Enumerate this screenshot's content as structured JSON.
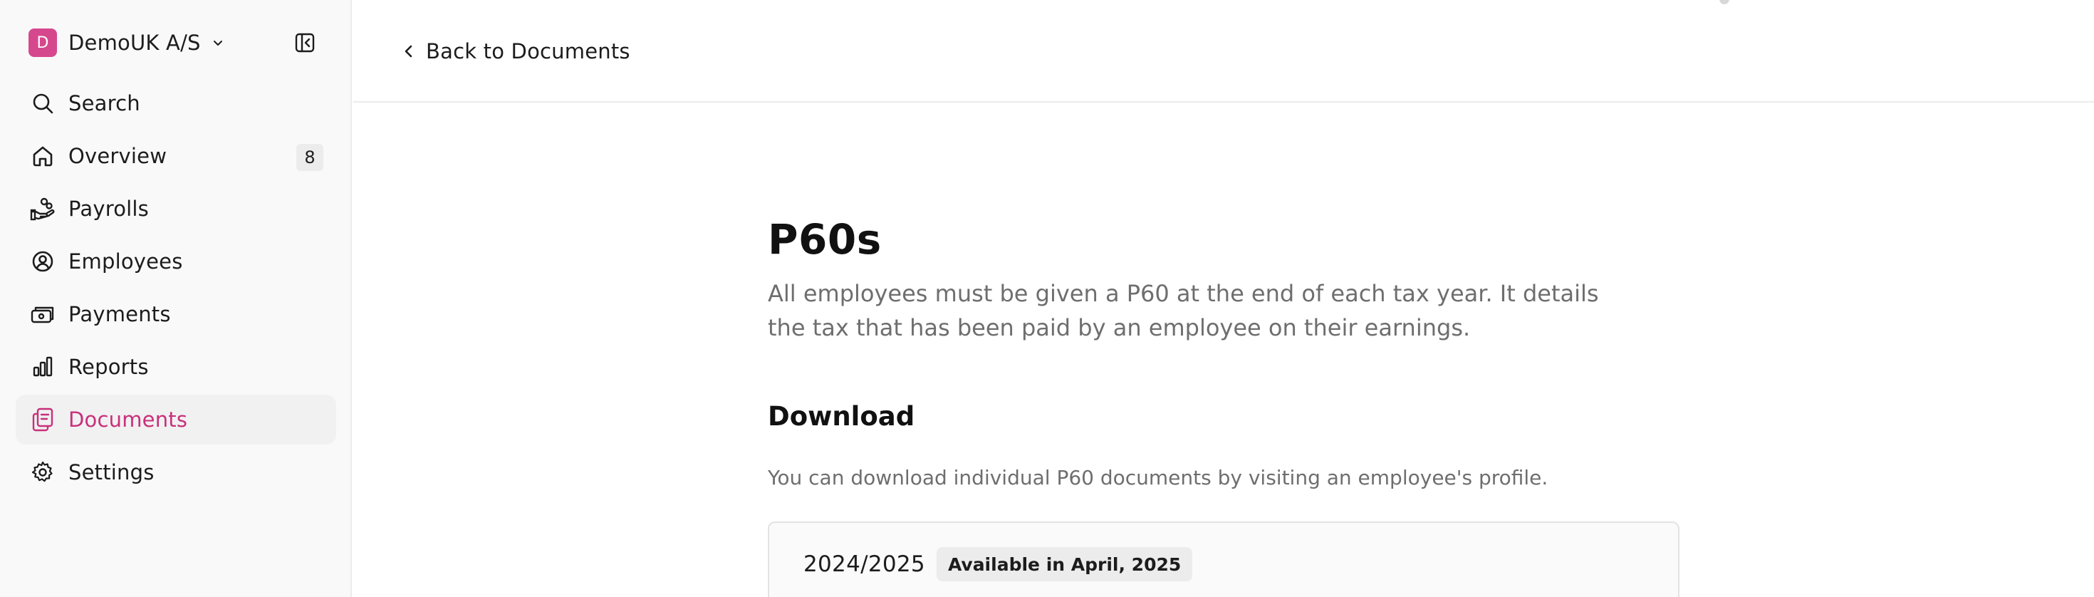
{
  "sidebar": {
    "workspace": {
      "initial": "D",
      "name": "DemoUK A/S"
    },
    "items": [
      {
        "id": "search",
        "label": "Search",
        "icon": "search-icon"
      },
      {
        "id": "overview",
        "label": "Overview",
        "icon": "home-icon",
        "count": "8"
      },
      {
        "id": "payrolls",
        "label": "Payrolls",
        "icon": "hand-coins-icon"
      },
      {
        "id": "employees",
        "label": "Employees",
        "icon": "user-circle-icon"
      },
      {
        "id": "payments",
        "label": "Payments",
        "icon": "banknote-icon"
      },
      {
        "id": "reports",
        "label": "Reports",
        "icon": "bar-chart-icon"
      },
      {
        "id": "documents",
        "label": "Documents",
        "icon": "document-icon",
        "active": true
      },
      {
        "id": "settings",
        "label": "Settings",
        "icon": "gear-icon"
      }
    ]
  },
  "topbar": {
    "back_label": "Back to Documents"
  },
  "main": {
    "title": "P60s",
    "description": "All employees must be given a P60 at the end of each tax year. It details the tax that has been paid by an employee on their earnings.",
    "download": {
      "title": "Download",
      "description": "You can download individual P60 documents by visiting an employee's profile.",
      "years": [
        {
          "label": "2024/2025",
          "badge": "Available in April, 2025"
        }
      ]
    }
  },
  "colors": {
    "accent": "#c8307b",
    "badge": "#d6488d",
    "muted_text": "#6e6e6e"
  }
}
